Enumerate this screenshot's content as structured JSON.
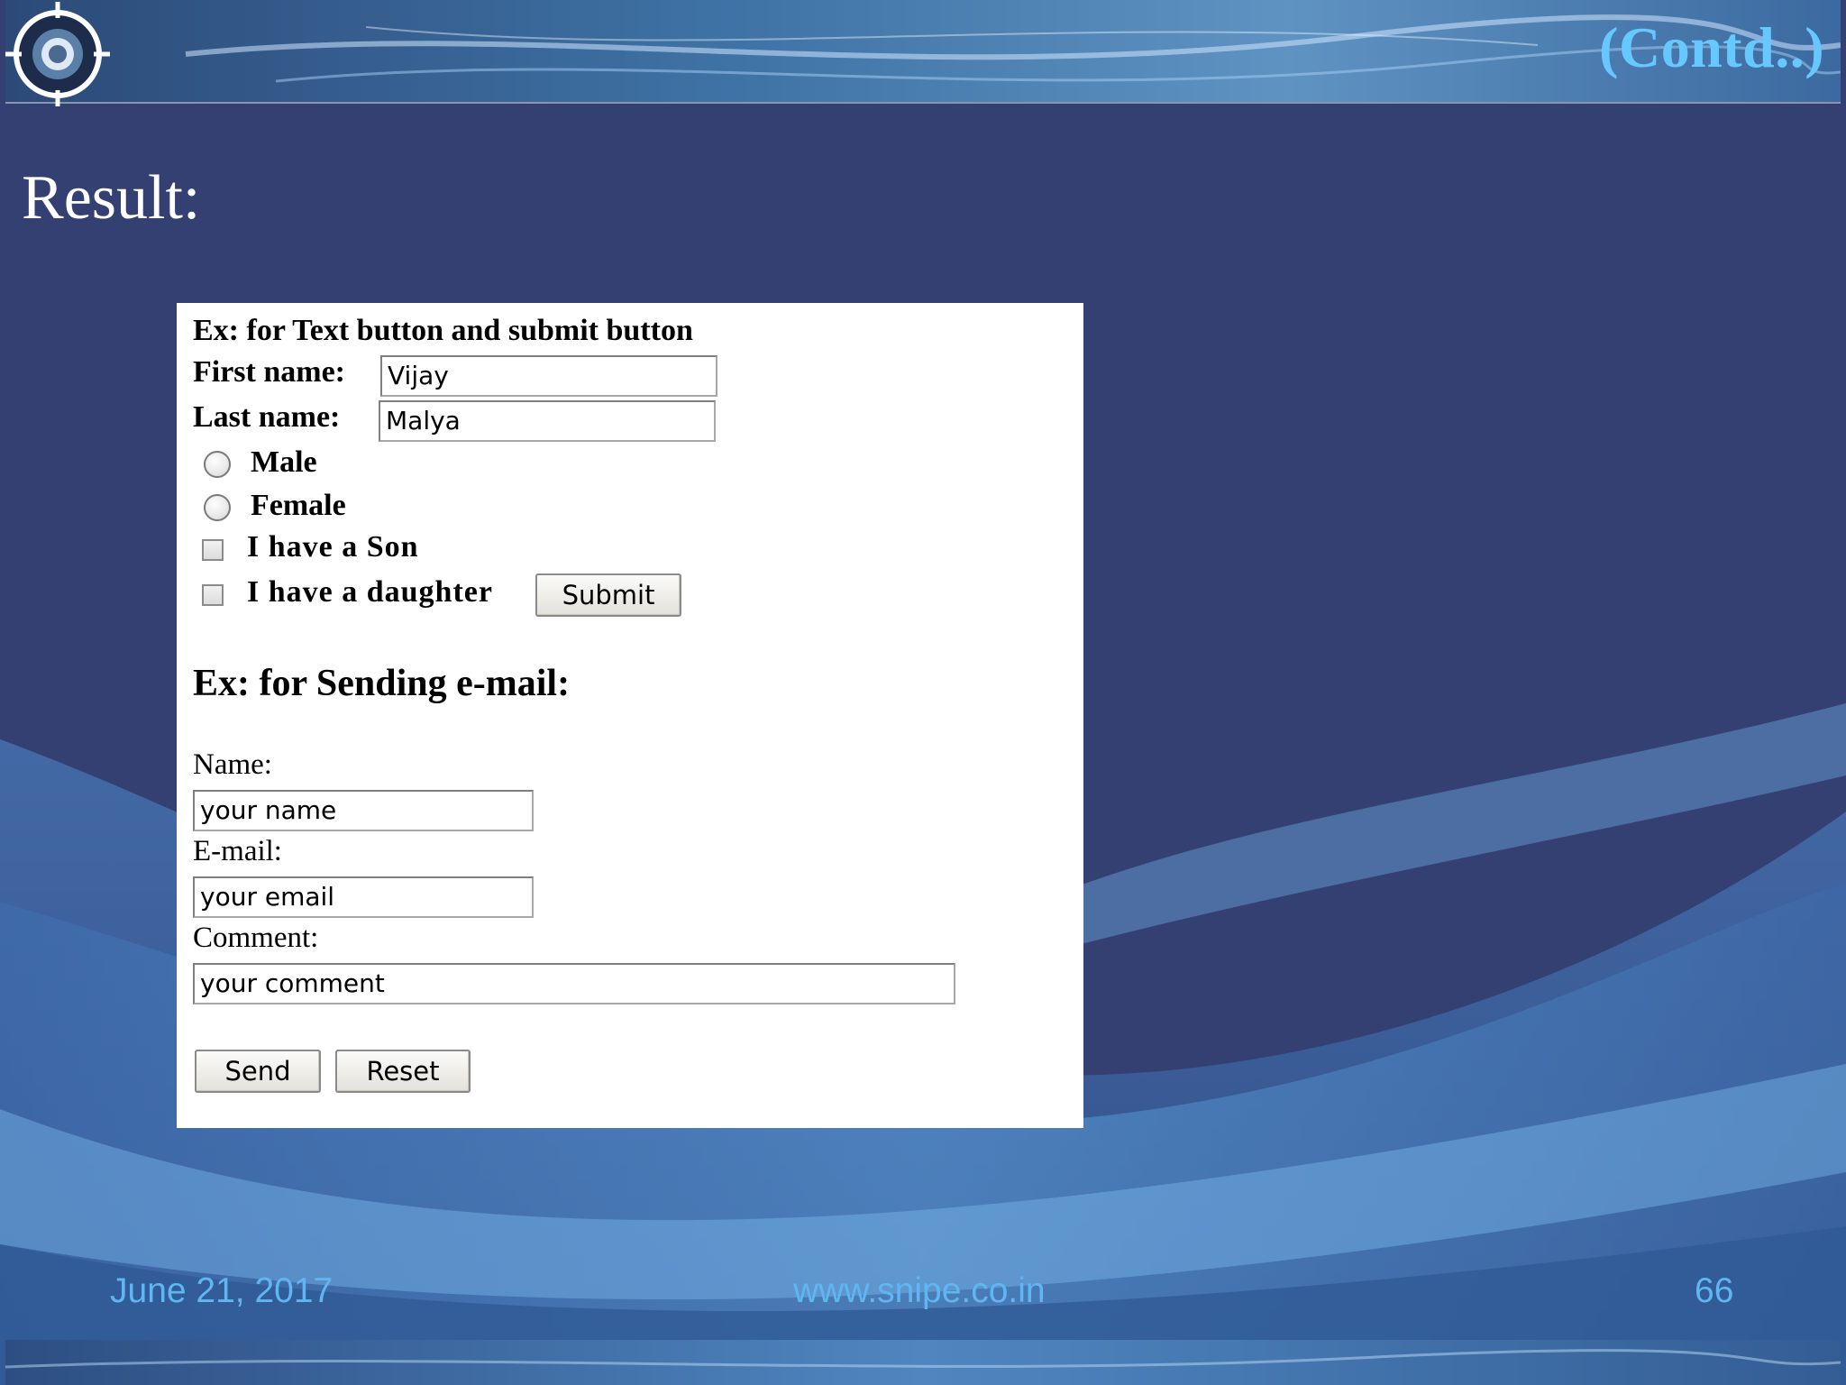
{
  "slide": {
    "contd": "(Contd..)",
    "title": "Result:"
  },
  "form_demo": {
    "heading1": "Ex: for Text button and submit button",
    "first_name_label": "First name:",
    "first_name_value": "Vijay",
    "last_name_label": "Last name:",
    "last_name_value": "Malya",
    "radio_male": "Male",
    "radio_female": "Female",
    "check_son": "I have a Son",
    "check_daughter": "I have a daughter",
    "submit": "Submit",
    "heading2": "Ex: for Sending e-mail:",
    "name_label": "Name:",
    "name_value": "your name",
    "email_label": "E-mail:",
    "email_value": "your email",
    "comment_label": "Comment:",
    "comment_value": "your comment",
    "send": "Send",
    "reset": "Reset"
  },
  "footer": {
    "date": "June 21, 2017",
    "website": "www.snipe.co.in",
    "page": "66"
  },
  "colors": {
    "background": "#343f72",
    "accent": "#66c8ff",
    "footer_text": "#5fb6f0"
  }
}
